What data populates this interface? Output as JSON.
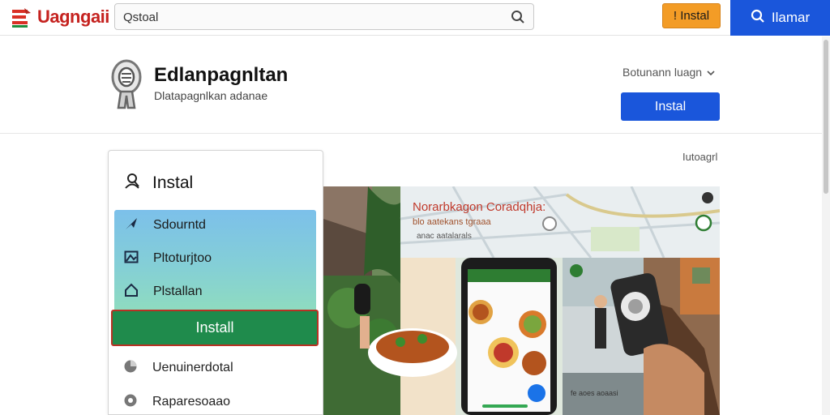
{
  "topbar": {
    "logo_text": "Uagngaii",
    "search_value": "Qstoal",
    "install_label": "! Instal",
    "cta_label": "Ilamar"
  },
  "app": {
    "name": "Edlanpagnltan",
    "subtitle": "Dlatapagnlkan adanae",
    "language": "Botunann luagn",
    "install_label": "Instal"
  },
  "panel": {
    "title": "Instal",
    "items": [
      {
        "label": "Sdourntd",
        "icon": "arrow-icon"
      },
      {
        "label": "Pltoturjtoo",
        "icon": "image-icon"
      },
      {
        "label": "Plstallan",
        "icon": "home-icon"
      }
    ],
    "install_label": "Install",
    "lower_items": [
      {
        "label": "Uenuinerdotal",
        "icon": "pie-icon"
      },
      {
        "label": "Raparesoaao",
        "icon": "settings-icon"
      }
    ]
  },
  "section_link": "Iutoagrl",
  "hero": {
    "map_title": "Norarbkagon Coradqhja:",
    "map_line1": "blo aatekans tgraaa",
    "map_line2": "anac aatalarals",
    "card_caption": "fe aoes aoaasi"
  },
  "colors": {
    "brand_blue": "#1a56db",
    "install_green": "#1f8b4c",
    "accent_orange": "#f39c26",
    "logo_red": "#c5221f"
  }
}
